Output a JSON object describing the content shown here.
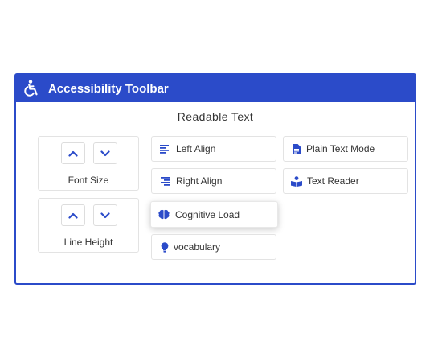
{
  "toolbar": {
    "title": "Accessibility Toolbar",
    "section_title": "Readable Text",
    "accent_color": "#2b4bc9",
    "controls": {
      "font_size": {
        "label": "Font Size"
      },
      "line_height": {
        "label": "Line Height"
      }
    },
    "options": {
      "left_align": {
        "label": "Left Align",
        "icon": "align-left-icon"
      },
      "right_align": {
        "label": "Right Align",
        "icon": "align-right-icon"
      },
      "cognitive_load": {
        "label": "Cognitive Load",
        "icon": "brain-icon",
        "active": true
      },
      "vocabulary": {
        "label": "vocabulary",
        "icon": "lightbulb-icon"
      },
      "plain_text": {
        "label": "Plain Text Mode",
        "icon": "document-icon"
      },
      "text_reader": {
        "label": "Text Reader",
        "icon": "reader-icon"
      }
    }
  }
}
